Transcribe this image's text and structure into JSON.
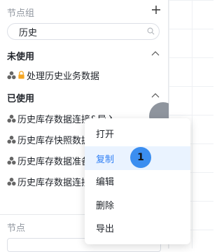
{
  "panel": {
    "title": "节点组",
    "add_icon": "plus-icon",
    "search": {
      "value": "历史",
      "icon": "search-icon"
    },
    "sections": {
      "unused": {
        "label": "未使用",
        "items": [
          {
            "label": "处理历史业务数据",
            "locked": true
          }
        ]
      },
      "used": {
        "label": "已使用",
        "items": [
          {
            "label": "历史库存数据连接&导入"
          },
          {
            "label": "历史库存快照数据"
          },
          {
            "label": "历史库存数据准备"
          },
          {
            "label": "历史库存数据连接"
          }
        ]
      }
    },
    "bottom_section_title": "节点"
  },
  "context_menu": {
    "items": [
      "打开",
      "复制",
      "编辑",
      "删除",
      "导出"
    ],
    "active_index": 1
  },
  "step_badge": "1",
  "colors": {
    "accent": "#2f7ff5",
    "badge": "#3b8ef0",
    "lock": "#f5a623",
    "menu_highlight": "#eaf3ff"
  }
}
